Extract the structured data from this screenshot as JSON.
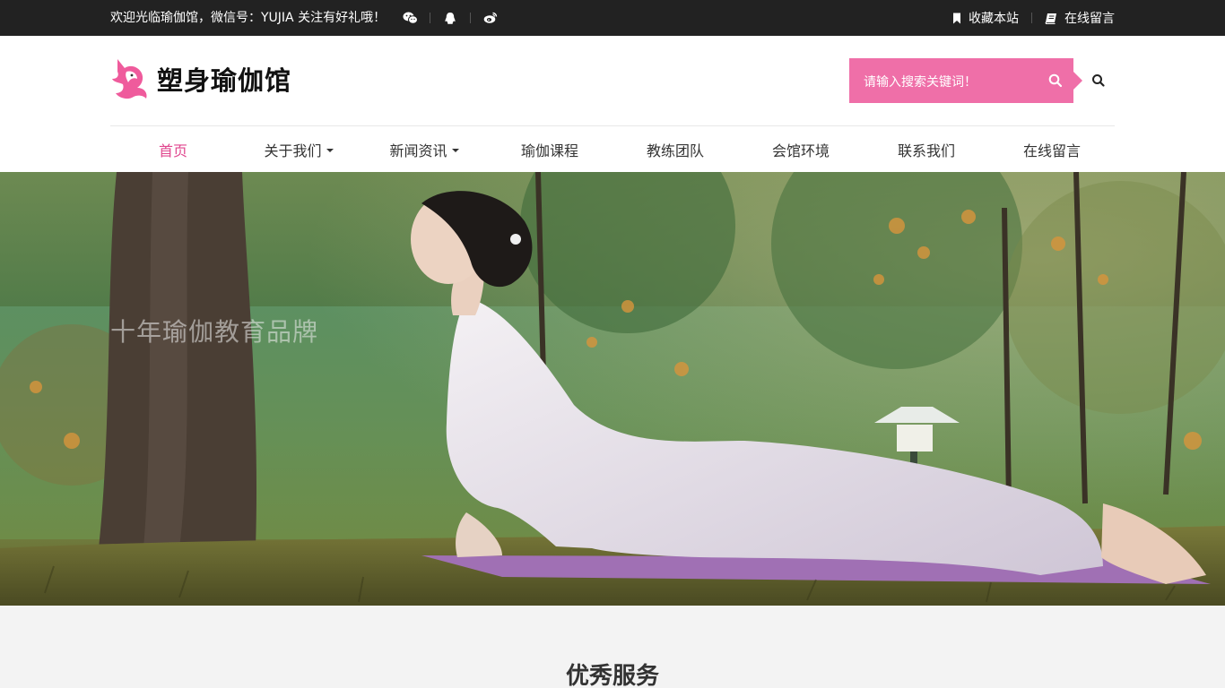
{
  "topbar": {
    "welcome": "欢迎光临瑜伽馆，微信号：YUJIA 关注有好礼哦！",
    "social_icons": [
      "wechat-icon",
      "qq-icon",
      "weibo-icon"
    ],
    "bookmark_label": "收藏本站",
    "message_label": "在线留言"
  },
  "header": {
    "logo_text": "塑身瑜伽馆",
    "search_placeholder": "请输入搜索关键词！"
  },
  "nav": {
    "items": [
      {
        "label": "首页",
        "active": true,
        "dropdown": false
      },
      {
        "label": "关于我们",
        "active": false,
        "dropdown": true
      },
      {
        "label": "新闻资讯",
        "active": false,
        "dropdown": true
      },
      {
        "label": "瑜伽课程",
        "active": false,
        "dropdown": false
      },
      {
        "label": "教练团队",
        "active": false,
        "dropdown": false
      },
      {
        "label": "会馆环境",
        "active": false,
        "dropdown": false
      },
      {
        "label": "联系我们",
        "active": false,
        "dropdown": false
      },
      {
        "label": "在线留言",
        "active": false,
        "dropdown": false
      }
    ]
  },
  "banner": {
    "slogan": "十年瑜伽教育品牌"
  },
  "section": {
    "title": "优秀服务"
  },
  "colors": {
    "accent": "#e0468e",
    "search_bg": "#ef6fa8",
    "topbar_bg": "#222222",
    "page_bg": "#f3f3f3"
  }
}
